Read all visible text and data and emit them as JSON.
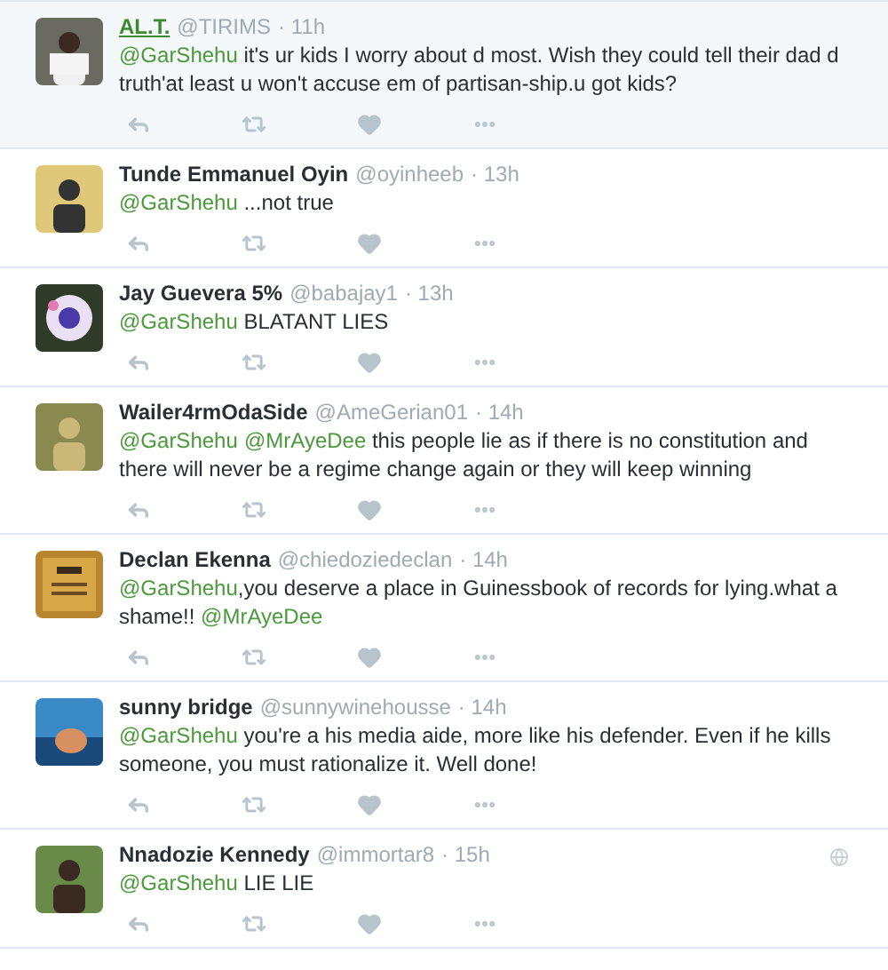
{
  "tweets": [
    {
      "name": "AL.T.",
      "handle": "@TIRIMS",
      "time": "· 11h",
      "hovered": true,
      "location_icon": false,
      "parts": [
        {
          "kind": "mention",
          "text": "@GarShehu"
        },
        {
          "kind": "plain",
          "text": "  it's ur kids I worry about d most. Wish they could tell their dad d truth'at least u won't accuse em of partisan-ship.u got kids?"
        }
      ]
    },
    {
      "name": "Tunde Emmanuel Oyin",
      "handle": "@oyinheeb",
      "time": "· 13h",
      "hovered": false,
      "location_icon": false,
      "parts": [
        {
          "kind": "mention",
          "text": "@GarShehu"
        },
        {
          "kind": "plain",
          "text": " ...not true"
        }
      ]
    },
    {
      "name": "Jay Guevera 5%",
      "handle": "@babajay1",
      "time": "· 13h",
      "hovered": false,
      "location_icon": false,
      "parts": [
        {
          "kind": "mention",
          "text": "@GarShehu"
        },
        {
          "kind": "plain",
          "text": " BLATANT LIES"
        }
      ]
    },
    {
      "name": "Wailer4rmOdaSide",
      "handle": "@AmeGerian01",
      "time": "· 14h",
      "hovered": false,
      "location_icon": false,
      "parts": [
        {
          "kind": "mention",
          "text": "@GarShehu"
        },
        {
          "kind": "mention",
          "text": "@MrAyeDee"
        },
        {
          "kind": "plain",
          "text": " this people lie as if there is no constitution and there will never be a regime change again or they will keep winning"
        }
      ]
    },
    {
      "name": "Declan Ekenna",
      "handle": "@chiedoziedeclan",
      "time": "· 14h",
      "hovered": false,
      "location_icon": false,
      "parts": [
        {
          "kind": "mention",
          "text": "@GarShehu"
        },
        {
          "kind": "plain",
          "text": ",you deserve a place in Guinessbook of records for lying.what a shame!! "
        },
        {
          "kind": "mention",
          "text": "@MrAyeDee"
        }
      ]
    },
    {
      "name": "sunny bridge",
      "handle": "@sunnywinehousse",
      "time": "· 14h",
      "hovered": false,
      "location_icon": false,
      "parts": [
        {
          "kind": "mention",
          "text": "@GarShehu"
        },
        {
          "kind": "plain",
          "text": "  you're a his media aide, more like his defender. Even if he kills someone, you must rationalize it. Well done!"
        }
      ]
    },
    {
      "name": "Nnadozie Kennedy",
      "handle": "@immortar8",
      "time": "· 15h",
      "hovered": false,
      "location_icon": true,
      "parts": [
        {
          "kind": "mention",
          "text": "@GarShehu"
        },
        {
          "kind": "plain",
          "text": " LIE LIE"
        }
      ]
    }
  ]
}
